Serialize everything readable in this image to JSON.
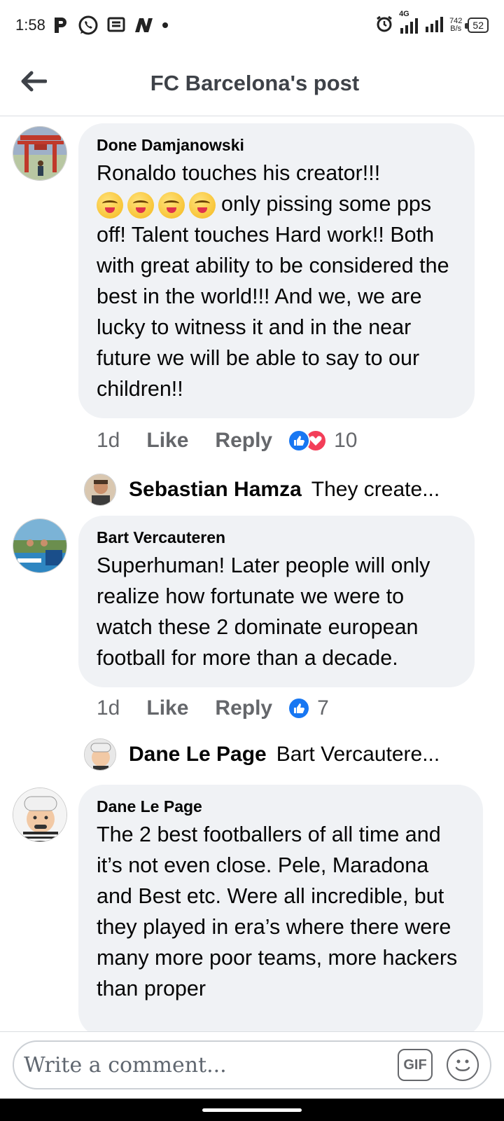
{
  "status_bar": {
    "time": "1:58",
    "network": "4G",
    "speed_value": "742",
    "speed_unit": "B/s",
    "battery": "52",
    "icons": [
      "p-icon",
      "whatsapp-icon",
      "message-icon",
      "n-icon",
      "dot-icon",
      "alarm-icon",
      "signal-icon",
      "signal-icon-2"
    ]
  },
  "header": {
    "title": "FC Barcelona's post",
    "back_icon": "arrow-left-icon"
  },
  "comments": [
    {
      "author": "Done Damjanowski",
      "line1": "Ronaldo touches his creator!!!",
      "text_after_emoji": "only pissing some pps off! Talent touches Hard work!! Both with great ability to be considered the best in the world!!! And we, we are lucky to witness it and in the near future we will be able to say to our children!!",
      "emoji_count": 4,
      "emoji_icon": "yum-face-emoji",
      "time": "1d",
      "like_label": "Like",
      "reply_label": "Reply",
      "reaction_count": "10",
      "reactions": [
        "like-reaction-icon",
        "love-reaction-icon"
      ],
      "reply_preview": {
        "name": "Sebastian Hamza",
        "text": "They create..."
      }
    },
    {
      "author": "Bart Vercauteren",
      "text": "Superhuman! Later people will only realize how fortunate we were to watch these 2 dominate european football for more than a decade.",
      "time": "1d",
      "like_label": "Like",
      "reply_label": "Reply",
      "reaction_count": "7",
      "reactions": [
        "like-reaction-icon"
      ],
      "reply_preview": {
        "name": "Dane Le Page",
        "text": "Bart Vercautere..."
      }
    },
    {
      "author": "Dane Le Page",
      "text": "The 2 best footballers of all time and it’s not even close. Pele, Maradona and Best etc. Were all incredible, but they played in era’s where there were many more poor teams, more hackers than proper"
    }
  ],
  "composer": {
    "placeholder": "Write a comment...",
    "gif_label": "GIF",
    "emoji_icon": "smiley-icon"
  },
  "colors": {
    "bubble": "#f0f2f5",
    "like_blue": "#1877f2",
    "love_red": "#f33e58",
    "meta_gray": "#65676b"
  }
}
